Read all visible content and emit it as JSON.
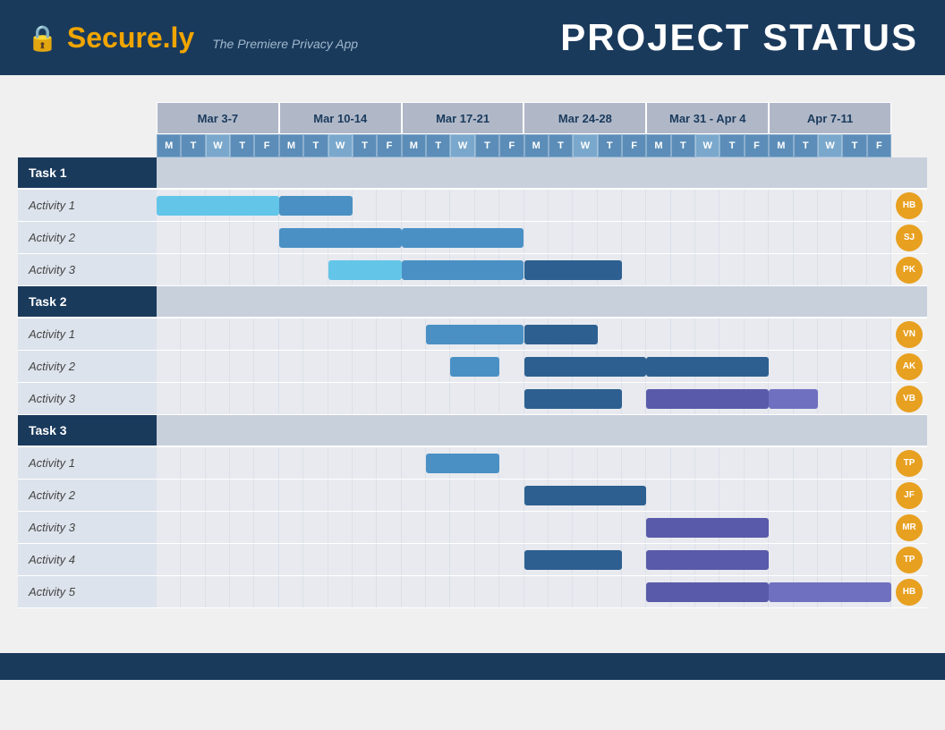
{
  "header": {
    "logo_icon": "🔒",
    "logo_prefix": "Secure.",
    "logo_suffix": "ly",
    "tagline": "The Premiere Privacy App",
    "project_title": "PROJECT STATUS"
  },
  "weeks": [
    {
      "label": "Mar 3-7"
    },
    {
      "label": "Mar 10-14"
    },
    {
      "label": "Mar 17-21"
    },
    {
      "label": "Mar 24-28"
    },
    {
      "label": "Mar 31 - Apr 4"
    },
    {
      "label": "Apr 7-11"
    }
  ],
  "days": [
    "M",
    "T",
    "W",
    "T",
    "F",
    "M",
    "T",
    "W",
    "T",
    "F",
    "M",
    "T",
    "W",
    "T",
    "F",
    "M",
    "T",
    "W",
    "T",
    "F",
    "M",
    "T",
    "W",
    "T",
    "F",
    "M",
    "T",
    "W",
    "T",
    "F"
  ],
  "tasks": [
    {
      "id": "task1",
      "label": "Task 1",
      "activities": [
        {
          "label": "Activity 1",
          "avatar": "HB",
          "bars": [
            {
              "start": 0,
              "span": 5,
              "color": "lightblue"
            },
            {
              "start": 5,
              "span": 3,
              "color": "blue"
            }
          ]
        },
        {
          "label": "Activity 2",
          "avatar": "SJ",
          "bars": [
            {
              "start": 5,
              "span": 5,
              "color": "blue"
            },
            {
              "start": 10,
              "span": 5,
              "color": "blue"
            }
          ]
        },
        {
          "label": "Activity 3",
          "avatar": "PK",
          "bars": [
            {
              "start": 7,
              "span": 3,
              "color": "lightblue"
            },
            {
              "start": 10,
              "span": 5,
              "color": "blue"
            },
            {
              "start": 15,
              "span": 4,
              "color": "darkblue"
            }
          ]
        }
      ]
    },
    {
      "id": "task2",
      "label": "Task 2",
      "activities": [
        {
          "label": "Activity 1",
          "avatar": "VN",
          "bars": [
            {
              "start": 11,
              "span": 4,
              "color": "blue"
            },
            {
              "start": 15,
              "span": 3,
              "color": "darkblue"
            }
          ]
        },
        {
          "label": "Activity 2",
          "avatar": "AK",
          "bars": [
            {
              "start": 12,
              "span": 2,
              "color": "blue"
            },
            {
              "start": 15,
              "span": 5,
              "color": "darkblue"
            },
            {
              "start": 20,
              "span": 5,
              "color": "darkblue"
            }
          ]
        },
        {
          "label": "Activity 3",
          "avatar": "VB",
          "bars": [
            {
              "start": 15,
              "span": 4,
              "color": "darkblue"
            },
            {
              "start": 20,
              "span": 5,
              "color": "purple"
            },
            {
              "start": 25,
              "span": 2,
              "color": "mediumpurple"
            }
          ]
        }
      ]
    },
    {
      "id": "task3",
      "label": "Task 3",
      "activities": [
        {
          "label": "Activity 1",
          "avatar": "TP",
          "bars": [
            {
              "start": 11,
              "span": 3,
              "color": "blue"
            }
          ]
        },
        {
          "label": "Activity 2",
          "avatar": "JF",
          "bars": [
            {
              "start": 15,
              "span": 5,
              "color": "darkblue"
            }
          ]
        },
        {
          "label": "Activity 3",
          "avatar": "MR",
          "bars": [
            {
              "start": 20,
              "span": 5,
              "color": "purple"
            }
          ]
        },
        {
          "label": "Activity 4",
          "avatar": "TP",
          "bars": [
            {
              "start": 15,
              "span": 4,
              "color": "darkblue"
            },
            {
              "start": 20,
              "span": 5,
              "color": "purple"
            }
          ]
        },
        {
          "label": "Activity 5",
          "avatar": "HB",
          "bars": [
            {
              "start": 20,
              "span": 5,
              "color": "purple"
            },
            {
              "start": 25,
              "span": 5,
              "color": "mediumpurple"
            }
          ]
        }
      ]
    }
  ],
  "avatar_colors": {
    "HB": "#e8a020",
    "SJ": "#e8a020",
    "PK": "#e8a020",
    "VN": "#e8a020",
    "AK": "#e8a020",
    "VB": "#e8a020",
    "TP": "#e8a020",
    "JF": "#e8a020",
    "MR": "#e8a020"
  }
}
